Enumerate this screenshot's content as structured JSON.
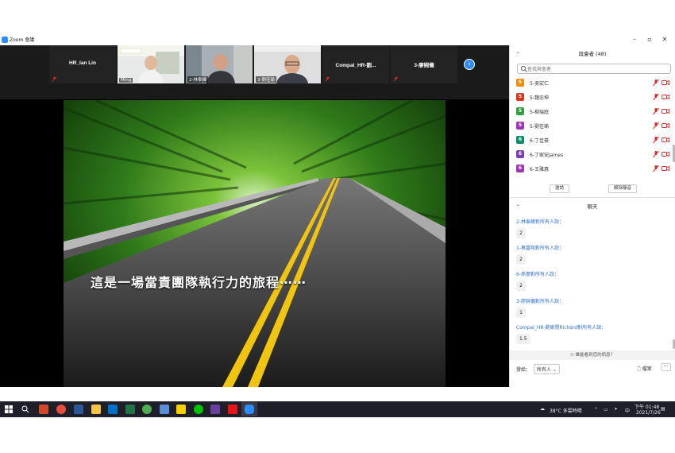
{
  "window": {
    "title": "Zoom 會議"
  },
  "thumbnails": [
    {
      "name": "HR_Ian Lin",
      "type": "name"
    },
    {
      "caption": "Ming",
      "type": "video"
    },
    {
      "caption": "2-林泰緯",
      "type": "video"
    },
    {
      "caption": "3-劉佳瑜",
      "type": "video"
    },
    {
      "name": "Compal_HR-劉...",
      "type": "name"
    },
    {
      "name": "3-廖婉儀",
      "type": "name"
    }
  ],
  "share": {
    "overlay_text": "這是一場當責團隊執行力的旅程⋯⋯"
  },
  "participants": {
    "header": "與會者 (48)",
    "search_placeholder": "查找與會者",
    "list": [
      {
        "initial": "5",
        "name": "5-吳宏仁",
        "color": "#f08c00"
      },
      {
        "initial": "5",
        "name": "5-魏忠坤",
        "color": "#d9381e"
      },
      {
        "initial": "5",
        "name": "5-柳瑞庭",
        "color": "#2f9e44"
      },
      {
        "initial": "5",
        "name": "5-劉佳瑜",
        "color": "#9c36b5"
      },
      {
        "initial": "6",
        "name": "6-丁佳豪",
        "color": "#0b8f6a"
      },
      {
        "initial": "6",
        "name": "6-丁家安James",
        "color": "#7b3fb5"
      },
      {
        "initial": "6",
        "name": "6-王雅惠",
        "color": "#9c36b5"
      }
    ],
    "invite_label": "邀請",
    "unmute_label": "解除靜音"
  },
  "chat": {
    "header": "聊天",
    "messages": [
      {
        "sender": "2-林泰緯對所有人說：",
        "text": "2"
      },
      {
        "sender": "1-蔡富翔對所有人說：",
        "text": "2"
      },
      {
        "sender": "6-孫豪對所有人說：",
        "text": "2"
      },
      {
        "sender": "3-廖婉儀對所有人說：",
        "text": "1"
      },
      {
        "sender": "Compal_HR-劉家賢Richard對所有人說：",
        "text": "1.5"
      }
    ],
    "who_can_see": "誰能看到您的訊息？",
    "send_to_label": "發給：",
    "send_to_value": "所有人",
    "file_label": "檔案",
    "more_label": "···"
  },
  "taskbar": {
    "weather": "38°C  多雲時晴",
    "time": "下午 01:48",
    "date": "2021/7/26",
    "ime": "中"
  }
}
